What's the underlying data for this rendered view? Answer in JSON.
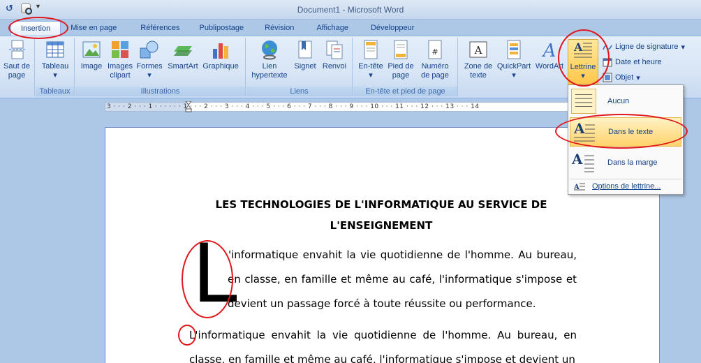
{
  "window": {
    "title": "Document1 - Microsoft Word"
  },
  "tabs": [
    "Insertion",
    "Mise en page",
    "Références",
    "Publipostage",
    "Révision",
    "Affichage",
    "Développeur"
  ],
  "ribbon": {
    "pages_group": {
      "btn_label_1": "Saut de",
      "btn_label_2": "page"
    },
    "tableaux_group": {
      "label": "Tableaux",
      "btn_label": "Tableau"
    },
    "illustrations_group": {
      "label": "Illustrations",
      "image": "Image",
      "clipart_1": "Images",
      "clipart_2": "clipart",
      "formes": "Formes",
      "smartart": "SmartArt",
      "graphique": "Graphique"
    },
    "liens_group": {
      "label": "Liens",
      "lien_1": "Lien",
      "lien_2": "hypertexte",
      "signet": "Signet",
      "renvoi": "Renvoi"
    },
    "entete_group": {
      "label": "En-tête et pied de page",
      "entete": "En-tête",
      "pied_1": "Pied de",
      "pied_2": "page",
      "numero_1": "Numéro",
      "numero_2": "de page"
    },
    "texte_group": {
      "zone_1": "Zone de",
      "zone_2": "texte",
      "quickpart": "QuickPart",
      "wordart": "WordArt",
      "lettrine": "Lettrine",
      "signature": "Ligne de signature",
      "date": "Date et heure",
      "objet": "Objet"
    }
  },
  "ruler": {
    "text": "3 · · · 2 · · · 1 · · ·  · · · 1 · · · 2 · · · 3 · · · 4 · · · 5 · · · 6 · · · 7 · · · 8 · · · 9 · · · 10 · · · 11 · · · 12 · · · 13 · · · 14"
  },
  "document": {
    "title_line1": "LES TECHNOLOGIES  DE L'INFORMATIQUE AU SERVICE DE",
    "title_line2": "L'ENSEIGNEMENT",
    "dropcap": "L",
    "para1_line1": "'informatique envahit la vie quotidienne de l'homme. Au bureau,",
    "para1_line2": "en classe, en famille et même au café, l'informatique s'impose et",
    "para1_line3": "devient un passage forcé à toute réussite ou performance.",
    "para2": "L'informatique envahit la vie quotidienne de l'homme. Au bureau, en classe, en famille et même au café, l'informatique s'impose et devient un"
  },
  "lettrine_menu": {
    "aucun": "Aucun",
    "dans_le_texte": "Dans le texte",
    "dans_la_marge": "Dans la marge",
    "options": "Options de lettrine..."
  },
  "colors": {
    "annotation": "#e0161c",
    "ribbon_text": "#15428b",
    "highlight": "#ffd26b"
  }
}
